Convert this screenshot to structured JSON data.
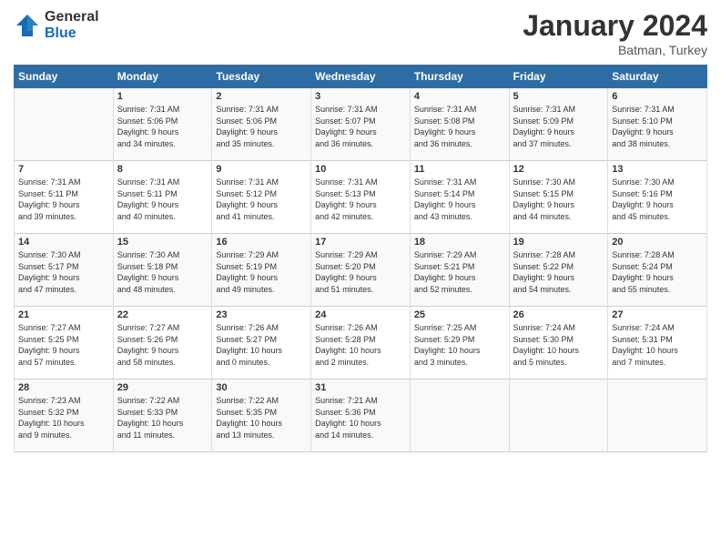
{
  "logo": {
    "general": "General",
    "blue": "Blue"
  },
  "title": "January 2024",
  "location": "Batman, Turkey",
  "days_of_week": [
    "Sunday",
    "Monday",
    "Tuesday",
    "Wednesday",
    "Thursday",
    "Friday",
    "Saturday"
  ],
  "weeks": [
    [
      {
        "day": "",
        "info": ""
      },
      {
        "day": "1",
        "info": "Sunrise: 7:31 AM\nSunset: 5:06 PM\nDaylight: 9 hours\nand 34 minutes."
      },
      {
        "day": "2",
        "info": "Sunrise: 7:31 AM\nSunset: 5:06 PM\nDaylight: 9 hours\nand 35 minutes."
      },
      {
        "day": "3",
        "info": "Sunrise: 7:31 AM\nSunset: 5:07 PM\nDaylight: 9 hours\nand 36 minutes."
      },
      {
        "day": "4",
        "info": "Sunrise: 7:31 AM\nSunset: 5:08 PM\nDaylight: 9 hours\nand 36 minutes."
      },
      {
        "day": "5",
        "info": "Sunrise: 7:31 AM\nSunset: 5:09 PM\nDaylight: 9 hours\nand 37 minutes."
      },
      {
        "day": "6",
        "info": "Sunrise: 7:31 AM\nSunset: 5:10 PM\nDaylight: 9 hours\nand 38 minutes."
      }
    ],
    [
      {
        "day": "7",
        "info": "Sunrise: 7:31 AM\nSunset: 5:11 PM\nDaylight: 9 hours\nand 39 minutes."
      },
      {
        "day": "8",
        "info": "Sunrise: 7:31 AM\nSunset: 5:11 PM\nDaylight: 9 hours\nand 40 minutes."
      },
      {
        "day": "9",
        "info": "Sunrise: 7:31 AM\nSunset: 5:12 PM\nDaylight: 9 hours\nand 41 minutes."
      },
      {
        "day": "10",
        "info": "Sunrise: 7:31 AM\nSunset: 5:13 PM\nDaylight: 9 hours\nand 42 minutes."
      },
      {
        "day": "11",
        "info": "Sunrise: 7:31 AM\nSunset: 5:14 PM\nDaylight: 9 hours\nand 43 minutes."
      },
      {
        "day": "12",
        "info": "Sunrise: 7:30 AM\nSunset: 5:15 PM\nDaylight: 9 hours\nand 44 minutes."
      },
      {
        "day": "13",
        "info": "Sunrise: 7:30 AM\nSunset: 5:16 PM\nDaylight: 9 hours\nand 45 minutes."
      }
    ],
    [
      {
        "day": "14",
        "info": "Sunrise: 7:30 AM\nSunset: 5:17 PM\nDaylight: 9 hours\nand 47 minutes."
      },
      {
        "day": "15",
        "info": "Sunrise: 7:30 AM\nSunset: 5:18 PM\nDaylight: 9 hours\nand 48 minutes."
      },
      {
        "day": "16",
        "info": "Sunrise: 7:29 AM\nSunset: 5:19 PM\nDaylight: 9 hours\nand 49 minutes."
      },
      {
        "day": "17",
        "info": "Sunrise: 7:29 AM\nSunset: 5:20 PM\nDaylight: 9 hours\nand 51 minutes."
      },
      {
        "day": "18",
        "info": "Sunrise: 7:29 AM\nSunset: 5:21 PM\nDaylight: 9 hours\nand 52 minutes."
      },
      {
        "day": "19",
        "info": "Sunrise: 7:28 AM\nSunset: 5:22 PM\nDaylight: 9 hours\nand 54 minutes."
      },
      {
        "day": "20",
        "info": "Sunrise: 7:28 AM\nSunset: 5:24 PM\nDaylight: 9 hours\nand 55 minutes."
      }
    ],
    [
      {
        "day": "21",
        "info": "Sunrise: 7:27 AM\nSunset: 5:25 PM\nDaylight: 9 hours\nand 57 minutes."
      },
      {
        "day": "22",
        "info": "Sunrise: 7:27 AM\nSunset: 5:26 PM\nDaylight: 9 hours\nand 58 minutes."
      },
      {
        "day": "23",
        "info": "Sunrise: 7:26 AM\nSunset: 5:27 PM\nDaylight: 10 hours\nand 0 minutes."
      },
      {
        "day": "24",
        "info": "Sunrise: 7:26 AM\nSunset: 5:28 PM\nDaylight: 10 hours\nand 2 minutes."
      },
      {
        "day": "25",
        "info": "Sunrise: 7:25 AM\nSunset: 5:29 PM\nDaylight: 10 hours\nand 3 minutes."
      },
      {
        "day": "26",
        "info": "Sunrise: 7:24 AM\nSunset: 5:30 PM\nDaylight: 10 hours\nand 5 minutes."
      },
      {
        "day": "27",
        "info": "Sunrise: 7:24 AM\nSunset: 5:31 PM\nDaylight: 10 hours\nand 7 minutes."
      }
    ],
    [
      {
        "day": "28",
        "info": "Sunrise: 7:23 AM\nSunset: 5:32 PM\nDaylight: 10 hours\nand 9 minutes."
      },
      {
        "day": "29",
        "info": "Sunrise: 7:22 AM\nSunset: 5:33 PM\nDaylight: 10 hours\nand 11 minutes."
      },
      {
        "day": "30",
        "info": "Sunrise: 7:22 AM\nSunset: 5:35 PM\nDaylight: 10 hours\nand 13 minutes."
      },
      {
        "day": "31",
        "info": "Sunrise: 7:21 AM\nSunset: 5:36 PM\nDaylight: 10 hours\nand 14 minutes."
      },
      {
        "day": "",
        "info": ""
      },
      {
        "day": "",
        "info": ""
      },
      {
        "day": "",
        "info": ""
      }
    ]
  ]
}
